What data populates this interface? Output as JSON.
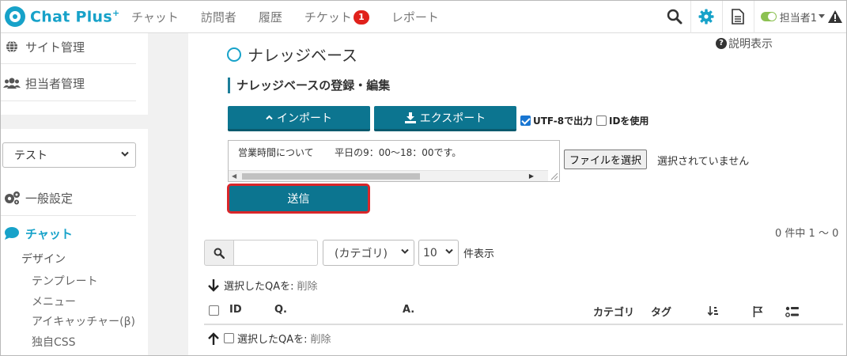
{
  "header": {
    "logo_text": "Chat Plus",
    "logo_plus": "+",
    "nav": [
      {
        "label": "チャット"
      },
      {
        "label": "訪問者"
      },
      {
        "label": "履歴"
      },
      {
        "label": "チケット",
        "badge": "1"
      },
      {
        "label": "レポート"
      }
    ],
    "user_label": "担当者1",
    "accent": "#17a2c9"
  },
  "sidebar": {
    "site_admin": "サイト管理",
    "staff_admin": "担当者管理",
    "site_select_value": "テスト",
    "general_settings": "一般設定",
    "chat_heading": "チャット",
    "design": "デザイン",
    "sub_items": [
      "テンプレート",
      "メニュー",
      "アイキャッチャー(β)",
      "独自CSS"
    ]
  },
  "main": {
    "page_title": "ナレッジベース",
    "help_label": "説明表示",
    "section_title": "ナレッジベースの登録・編集",
    "import_label": "インポート",
    "export_label": "エクスポート",
    "utf8_label": "UTF-8で出力",
    "utf8_checked": true,
    "id_label": "IDを使用",
    "id_checked": false,
    "textarea_value": "営業時間について\t平日の9：00〜18：00です。",
    "file_button": "ファイルを選択",
    "file_status": "選択されていません",
    "send_label": "送信",
    "count_text": "0 件中 1 〜 0",
    "category_select": "(カテゴリ)",
    "per_page_select": "10",
    "per_page_label": "件表示",
    "bulk_label": "選択したQAを:",
    "bulk_delete": "削除",
    "table_headers": {
      "id": "ID",
      "question": "Q.",
      "answer": "A.",
      "category": "カテゴリ",
      "tag": "タグ"
    },
    "brand_color": "#0c7590",
    "highlight_color": "#d9262a"
  }
}
